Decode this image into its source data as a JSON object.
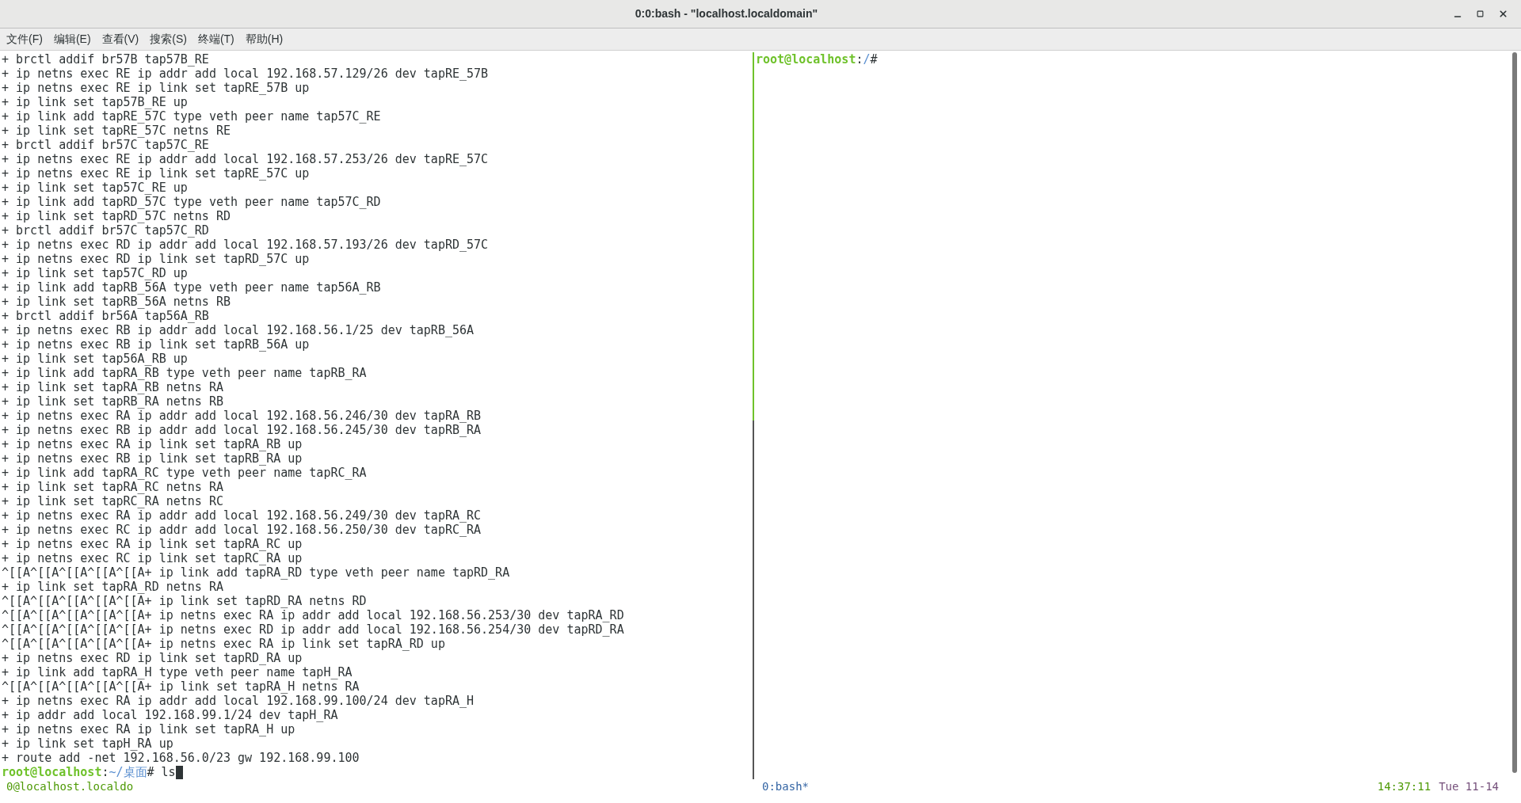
{
  "window": {
    "title": "0:0:bash - \"localhost.localdomain\""
  },
  "menu": [
    "文件(F)",
    "编辑(E)",
    "查看(V)",
    "搜索(S)",
    "终端(T)",
    "帮助(H)"
  ],
  "left_pane": {
    "lines": [
      "+ brctl addif br57B tap57B_RE",
      "+ ip netns exec RE ip addr add local 192.168.57.129/26 dev tapRE_57B",
      "+ ip netns exec RE ip link set tapRE_57B up",
      "+ ip link set tap57B_RE up",
      "+ ip link add tapRE_57C type veth peer name tap57C_RE",
      "+ ip link set tapRE_57C netns RE",
      "+ brctl addif br57C tap57C_RE",
      "+ ip netns exec RE ip addr add local 192.168.57.253/26 dev tapRE_57C",
      "+ ip netns exec RE ip link set tapRE_57C up",
      "+ ip link set tap57C_RE up",
      "+ ip link add tapRD_57C type veth peer name tap57C_RD",
      "+ ip link set tapRD_57C netns RD",
      "+ brctl addif br57C tap57C_RD",
      "+ ip netns exec RD ip addr add local 192.168.57.193/26 dev tapRD_57C",
      "+ ip netns exec RD ip link set tapRD_57C up",
      "+ ip link set tap57C_RD up",
      "+ ip link add tapRB_56A type veth peer name tap56A_RB",
      "+ ip link set tapRB_56A netns RB",
      "+ brctl addif br56A tap56A_RB",
      "+ ip netns exec RB ip addr add local 192.168.56.1/25 dev tapRB_56A",
      "+ ip netns exec RB ip link set tapRB_56A up",
      "+ ip link set tap56A_RB up",
      "+ ip link add tapRA_RB type veth peer name tapRB_RA",
      "+ ip link set tapRA_RB netns RA",
      "+ ip link set tapRB_RA netns RB",
      "+ ip netns exec RA ip addr add local 192.168.56.246/30 dev tapRA_RB",
      "+ ip netns exec RB ip addr add local 192.168.56.245/30 dev tapRB_RA",
      "+ ip netns exec RA ip link set tapRA_RB up",
      "+ ip netns exec RB ip link set tapRB_RA up",
      "+ ip link add tapRA_RC type veth peer name tapRC_RA",
      "+ ip link set tapRA_RC netns RA",
      "+ ip link set tapRC_RA netns RC",
      "+ ip netns exec RA ip addr add local 192.168.56.249/30 dev tapRA_RC",
      "+ ip netns exec RC ip addr add local 192.168.56.250/30 dev tapRC_RA",
      "+ ip netns exec RA ip link set tapRA_RC up",
      "+ ip netns exec RC ip link set tapRC_RA up",
      "^[[A^[[A^[[A^[[A^[[A+ ip link add tapRA_RD type veth peer name tapRD_RA",
      "+ ip link set tapRA_RD netns RA",
      "^[[A^[[A^[[A^[[A^[[A+ ip link set tapRD_RA netns RD",
      "^[[A^[[A^[[A^[[A^[[A+ ip netns exec RA ip addr add local 192.168.56.253/30 dev tapRA_RD",
      "^[[A^[[A^[[A^[[A^[[A+ ip netns exec RD ip addr add local 192.168.56.254/30 dev tapRD_RA",
      "^[[A^[[A^[[A^[[A^[[A+ ip netns exec RA ip link set tapRA_RD up",
      "+ ip netns exec RD ip link set tapRD_RA up",
      "+ ip link add tapRA_H type veth peer name tapH_RA",
      "^[[A^[[A^[[A^[[A^[[A+ ip link set tapRA_H netns RA",
      "+ ip netns exec RA ip addr add local 192.168.99.100/24 dev tapRA_H",
      "+ ip addr add local 192.168.99.1/24 dev tapH_RA",
      "+ ip netns exec RA ip link set tapRA_H up",
      "+ ip link set tapH_RA up",
      "+ route add -net 192.168.56.0/23 gw 192.168.99.100"
    ],
    "prompt": {
      "user": "root@localhost",
      "separator": ":",
      "path": "~/桌面",
      "symbol": "#",
      "input": "ls"
    }
  },
  "right_pane": {
    "prompt": {
      "user": "root@localhost",
      "separator": ":",
      "path": "/",
      "symbol": "#"
    }
  },
  "status_bar": {
    "session": "0@localhost.localdo",
    "window": "0:bash*",
    "time": "14:37:11",
    "date": "Tue 11-14"
  }
}
